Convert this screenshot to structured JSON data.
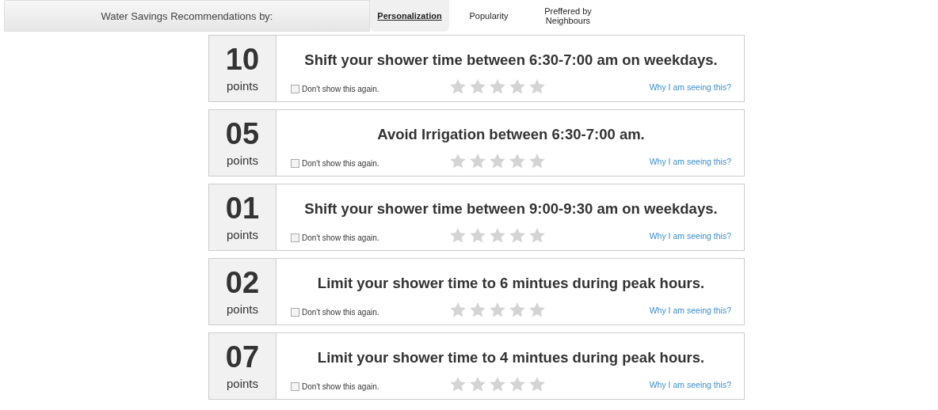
{
  "header": {
    "title": "Water Savings Recommendations by:"
  },
  "tabs": [
    {
      "label": "Personalization",
      "selected": true
    },
    {
      "label": "Popularity",
      "selected": false
    },
    {
      "label": "Preffered by Neighbours",
      "selected": false
    }
  ],
  "recommendations": [
    {
      "points": "10",
      "unit": "points",
      "text": "Shift your shower time between 6:30-7:00 am on weekdays.",
      "dismiss": "Don't show this again.",
      "checked": false,
      "stars": 0,
      "link": "Why I am seeing this?"
    },
    {
      "points": "05",
      "unit": "points",
      "text": "Avoid Irrigation between 6:30-7:00 am.",
      "dismiss": "Don't show this again.",
      "checked": false,
      "stars": 0,
      "link": "Why I am seeing this?"
    },
    {
      "points": "01",
      "unit": "points",
      "text": "Shift your shower time between 9:00-9:30 am on weekdays.",
      "dismiss": "Don't show this again.",
      "checked": false,
      "stars": 0,
      "link": "Why I am seeing this?"
    },
    {
      "points": "02",
      "unit": "points",
      "text": "Limit your shower time to 6 mintues during peak hours.",
      "dismiss": "Don't show this again.",
      "checked": false,
      "stars": 0,
      "link": "Why I am seeing this?"
    },
    {
      "points": "07",
      "unit": "points",
      "text": "Limit your shower time to 4 mintues during peak hours.",
      "dismiss": "Don't show this again.",
      "checked": false,
      "stars": 0,
      "link": "Why I am seeing this?"
    }
  ]
}
